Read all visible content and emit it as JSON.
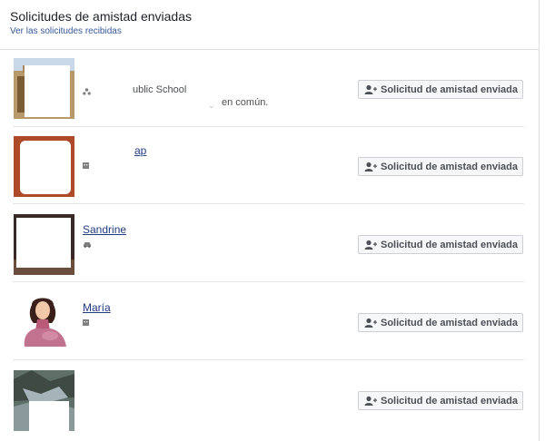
{
  "header": {
    "title": "Solicitudes de amistad enviadas",
    "received_link": "Ver las solicitudes recibidas"
  },
  "requests": [
    {
      "name": "",
      "detail": "ublic School",
      "mutual": "en común.",
      "button": "Solicitud de amistad enviada",
      "mini_icon": "group-icon"
    },
    {
      "name": "ap",
      "detail": "",
      "mutual": "",
      "button": "Solicitud de amistad enviada",
      "mini_icon": "building-icon"
    },
    {
      "name": "Sandrine",
      "detail": "",
      "mutual": "",
      "button": "Solicitud de amistad enviada",
      "mini_icon": "car-icon"
    },
    {
      "name": "María",
      "detail": "",
      "mutual": "",
      "button": "Solicitud de amistad enviada",
      "mini_icon": "building-icon"
    },
    {
      "name": "",
      "detail": "",
      "mutual": "",
      "button": "Solicitud de amistad enviada",
      "mini_icon": ""
    }
  ],
  "colors": {
    "link": "#365899",
    "name": "#1f3b82",
    "button_bg": "#f6f7f9",
    "divider": "#e5e5e5"
  }
}
